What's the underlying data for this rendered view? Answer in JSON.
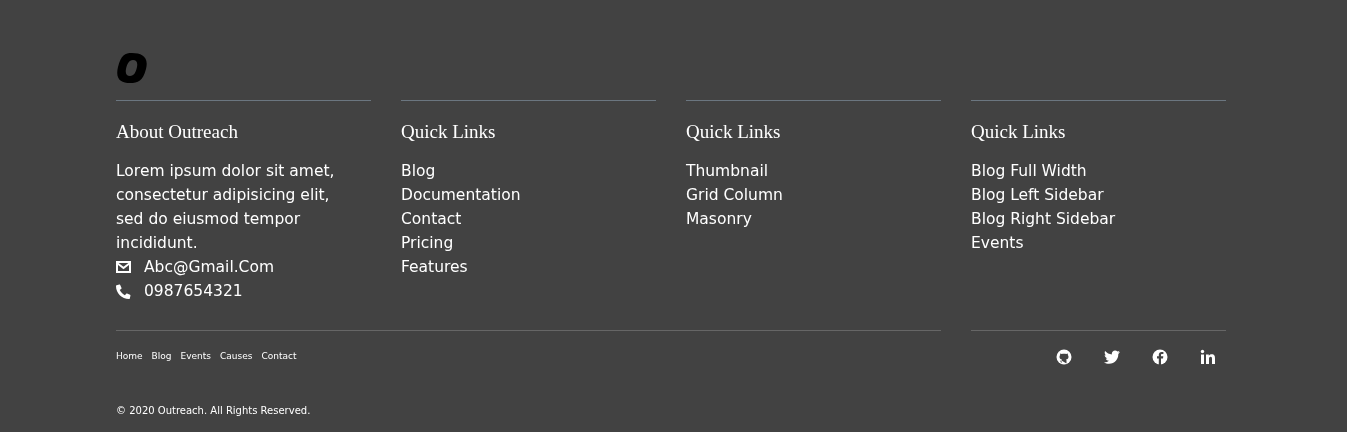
{
  "about": {
    "heading": "About Outreach",
    "text": "Lorem ipsum dolor sit amet, consectetur adipisicing elit, sed do eiusmod tempor incididunt.",
    "contacts": [
      {
        "kind": "email",
        "text": "Abc@Gmail.Com"
      },
      {
        "kind": "phone",
        "text": "0987654321"
      }
    ]
  },
  "link_columns": [
    {
      "heading": "Quick Links",
      "links": [
        "Blog",
        "Documentation",
        "Contact",
        "Pricing",
        "Features"
      ]
    },
    {
      "heading": "Quick Links",
      "links": [
        "Thumbnail",
        "Grid Column",
        "Masonry"
      ]
    },
    {
      "heading": "Quick Links",
      "links": [
        "Blog Full Width",
        "Blog Left Sidebar",
        "Blog Right Sidebar",
        "Events"
      ]
    }
  ],
  "footer_nav": [
    "Home",
    "Blog",
    "Events",
    "Causes",
    "Contact"
  ],
  "copyright": "© 2020 Outreach. All Rights Reserved."
}
